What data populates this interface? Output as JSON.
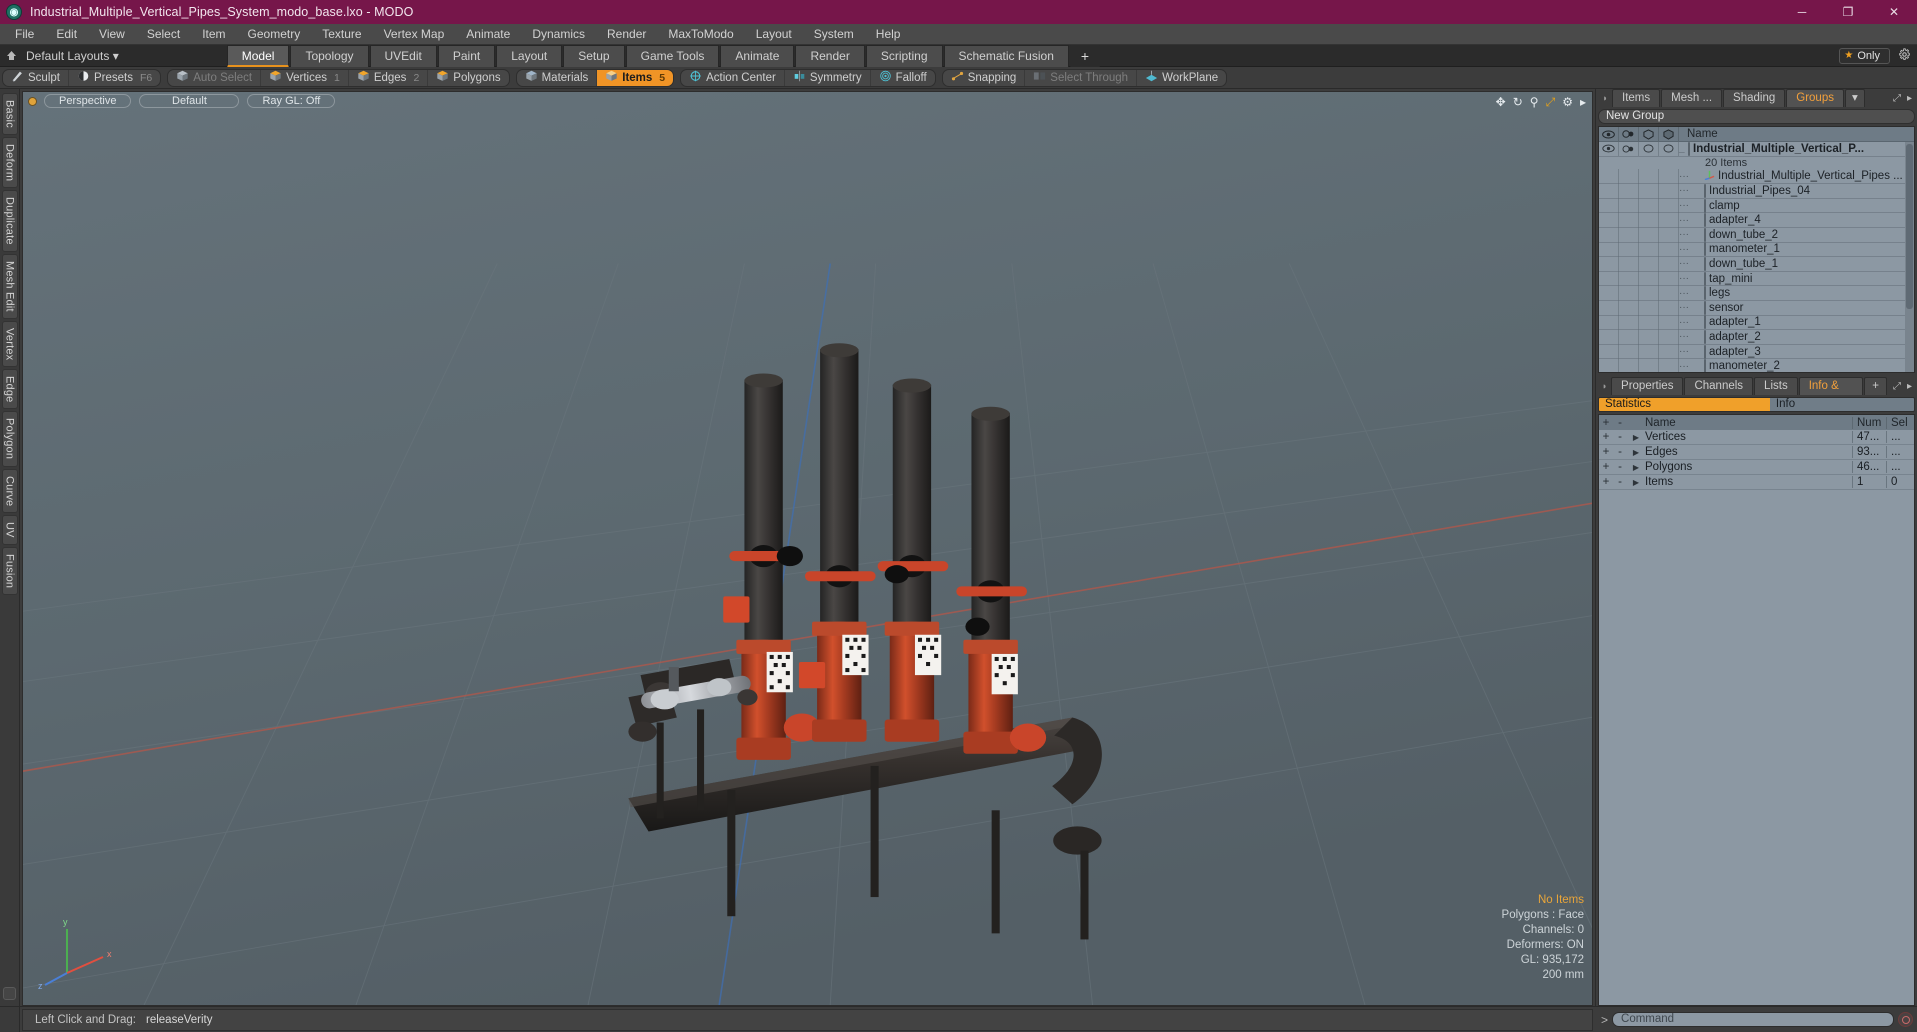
{
  "titlebar": {
    "logo": "modo-logo-icon",
    "title": "Industrial_Multiple_Vertical_Pipes_System_modo_base.lxo - MODO",
    "minimize": "─",
    "maximize": "❐",
    "close": "✕"
  },
  "menubar": {
    "items": [
      {
        "label": "File"
      },
      {
        "label": "Edit"
      },
      {
        "label": "View"
      },
      {
        "label": "Select"
      },
      {
        "label": "Item"
      },
      {
        "label": "Geometry"
      },
      {
        "label": "Texture"
      },
      {
        "label": "Vertex Map"
      },
      {
        "label": "Animate"
      },
      {
        "label": "Dynamics"
      },
      {
        "label": "Render"
      },
      {
        "label": "MaxToModo"
      },
      {
        "label": "Layout"
      },
      {
        "label": "System"
      },
      {
        "label": "Help"
      }
    ]
  },
  "layoutbar": {
    "home_icon": "home-icon",
    "layout_selector": "Default Layouts",
    "caret": "▾",
    "tabs": [
      {
        "label": "Model",
        "active": true
      },
      {
        "label": "Topology",
        "active": false
      },
      {
        "label": "UVEdit",
        "active": false
      },
      {
        "label": "Paint",
        "active": false
      },
      {
        "label": "Layout",
        "active": false
      },
      {
        "label": "Setup",
        "active": false
      },
      {
        "label": "Game Tools",
        "active": false
      },
      {
        "label": "Animate",
        "active": false
      },
      {
        "label": "Render",
        "active": false
      },
      {
        "label": "Scripting",
        "active": false
      },
      {
        "label": "Schematic Fusion",
        "active": false
      }
    ],
    "add_tab": "+",
    "only_button": {
      "star": "★",
      "label": "Only"
    },
    "gear_icon": "gear-icon"
  },
  "modebar": {
    "group1": [
      {
        "label": "Sculpt",
        "icon": "sculpt-brush-icon",
        "key": "",
        "state": "normal"
      },
      {
        "label": "Presets",
        "icon": "presets-sphere-icon",
        "key": "F6",
        "state": "normal"
      }
    ],
    "group2": [
      {
        "label": "Auto Select",
        "icon": "cube-grey-icon",
        "key": "",
        "state": "dim"
      },
      {
        "label": "Vertices",
        "icon": "cube-vertices-icon",
        "key": "1",
        "state": "normal"
      },
      {
        "label": "Edges",
        "icon": "cube-edges-icon",
        "key": "2",
        "state": "normal"
      },
      {
        "label": "Polygons",
        "icon": "cube-polygons-icon",
        "key": "",
        "state": "normal"
      }
    ],
    "group3": [
      {
        "label": "Materials",
        "icon": "cube-materials-icon",
        "key": "",
        "state": "normal"
      },
      {
        "label": "Items",
        "icon": "cube-items-icon",
        "key": "5",
        "state": "active"
      }
    ],
    "group4": [
      {
        "label": "Action Center",
        "icon": "action-center-icon",
        "key": "",
        "state": "normal"
      },
      {
        "label": "Symmetry",
        "icon": "symmetry-icon",
        "key": "",
        "state": "normal"
      },
      {
        "label": "Falloff",
        "icon": "falloff-icon",
        "key": "",
        "state": "normal"
      }
    ],
    "group5": [
      {
        "label": "Snapping",
        "icon": "snapping-icon",
        "key": "",
        "state": "normal"
      },
      {
        "label": "Select Through",
        "icon": "select-through-icon",
        "key": "",
        "state": "dim"
      },
      {
        "label": "WorkPlane",
        "icon": "workplane-icon",
        "key": "",
        "state": "normal"
      }
    ]
  },
  "leftstrip": {
    "tabs": [
      {
        "label": "Basic"
      },
      {
        "label": "Deform"
      },
      {
        "label": "Duplicate"
      },
      {
        "label": "Mesh Edit"
      },
      {
        "label": "Vertex"
      },
      {
        "label": "Edge"
      },
      {
        "label": "Polygon"
      },
      {
        "label": "Curve"
      },
      {
        "label": "UV"
      },
      {
        "label": "Fusion"
      }
    ]
  },
  "viewport": {
    "header": {
      "indicator": "viewport-active-dot",
      "pills": [
        "Perspective",
        "Default",
        "Ray GL: Off"
      ]
    },
    "corner_icons": [
      "move-viewport-icon",
      "rotate-viewport-icon",
      "zoom-viewport-icon",
      "fit-viewport-icon",
      "viewport-options-gear-icon",
      "viewport-menu-arrow-icon"
    ],
    "stats": {
      "selection": "No Items",
      "polygons": "Polygons : Face",
      "channels": "Channels: 0",
      "deformers": "Deformers: ON",
      "gl": "GL: 935,172",
      "grid": "200 mm"
    },
    "gizmo": {
      "x": "x",
      "y": "y",
      "z": "z"
    },
    "scene_label": "industrial-pipes-3d-model"
  },
  "rightpanel": {
    "tabs": [
      {
        "label": "Items",
        "active": false
      },
      {
        "label": "Mesh ...",
        "active": false
      },
      {
        "label": "Shading",
        "active": false
      },
      {
        "label": "Groups",
        "active": true
      }
    ],
    "tab_caret": "▾",
    "expand_icon": "expand-panel-icon",
    "more_icon": "panel-more-arrow-icon",
    "group_name": "New Group",
    "tree_headers": {
      "eye": "visibility-eye-icon",
      "render": "render-visibility-icon",
      "lock": "lock-shape-icon",
      "select": "selectable-shape-icon",
      "name": "Name"
    },
    "tree": [
      {
        "label": "Industrial_Multiple_Vertical_P...",
        "icon": "group-cube-icon",
        "root": true,
        "count": "20 Items"
      },
      {
        "label": "Industrial_Multiple_Vertical_Pipes ...",
        "icon": "locator-axis-icon",
        "root": false
      },
      {
        "label": "Industrial_Pipes_04",
        "icon": "mesh-cube-icon",
        "root": false
      },
      {
        "label": "clamp",
        "icon": "mesh-cube-icon",
        "root": false
      },
      {
        "label": "adapter_4",
        "icon": "mesh-cube-icon",
        "root": false
      },
      {
        "label": "down_tube_2",
        "icon": "mesh-cube-icon",
        "root": false
      },
      {
        "label": "manometer_1",
        "icon": "mesh-cube-icon",
        "root": false
      },
      {
        "label": "down_tube_1",
        "icon": "mesh-cube-icon",
        "root": false
      },
      {
        "label": "tap_mini",
        "icon": "mesh-cube-icon",
        "root": false
      },
      {
        "label": "legs",
        "icon": "mesh-cube-icon",
        "root": false
      },
      {
        "label": "sensor",
        "icon": "mesh-cube-icon",
        "root": false
      },
      {
        "label": "adapter_1",
        "icon": "mesh-cube-icon",
        "root": false
      },
      {
        "label": "adapter_2",
        "icon": "mesh-cube-icon",
        "root": false
      },
      {
        "label": "adapter_3",
        "icon": "mesh-cube-icon",
        "root": false
      },
      {
        "label": "manometer_2",
        "icon": "mesh-cube-icon",
        "root": false
      }
    ]
  },
  "statspanel": {
    "tabs": [
      {
        "label": "Properties",
        "active": false
      },
      {
        "label": "Channels",
        "active": false
      },
      {
        "label": "Lists",
        "active": false
      },
      {
        "label": "Info & Stat...",
        "active": true
      }
    ],
    "add_tab": "+",
    "expand_icon": "expand-panel-icon",
    "more_icon": "panel-more-arrow-icon",
    "segments": [
      {
        "label": "Statistics",
        "active": true
      },
      {
        "label": "Info",
        "active": false
      }
    ],
    "columns": {
      "plus": "+",
      "minus": "-",
      "name": "Name",
      "num": "Num",
      "sel": "Sel"
    },
    "rows": [
      {
        "name": "Vertices",
        "num": "47...",
        "sel": "..."
      },
      {
        "name": "Edges",
        "num": "93...",
        "sel": "..."
      },
      {
        "name": "Polygons",
        "num": "46...",
        "sel": "..."
      },
      {
        "name": "Items",
        "num": "1",
        "sel": "0"
      }
    ]
  },
  "bottombar": {
    "status_label": "Left Click and Drag:",
    "status_value": "releaseVerity",
    "command_arrow": ">",
    "command_placeholder": "Command",
    "record_icon": "record-macro-icon"
  },
  "colors": {
    "title_bar": "#76164a",
    "accent_orange": "#f0a02a",
    "panel_bg": "#3c3c3c",
    "tree_bg": "#8c98a3",
    "viewport_bg": "#5d6a71"
  }
}
